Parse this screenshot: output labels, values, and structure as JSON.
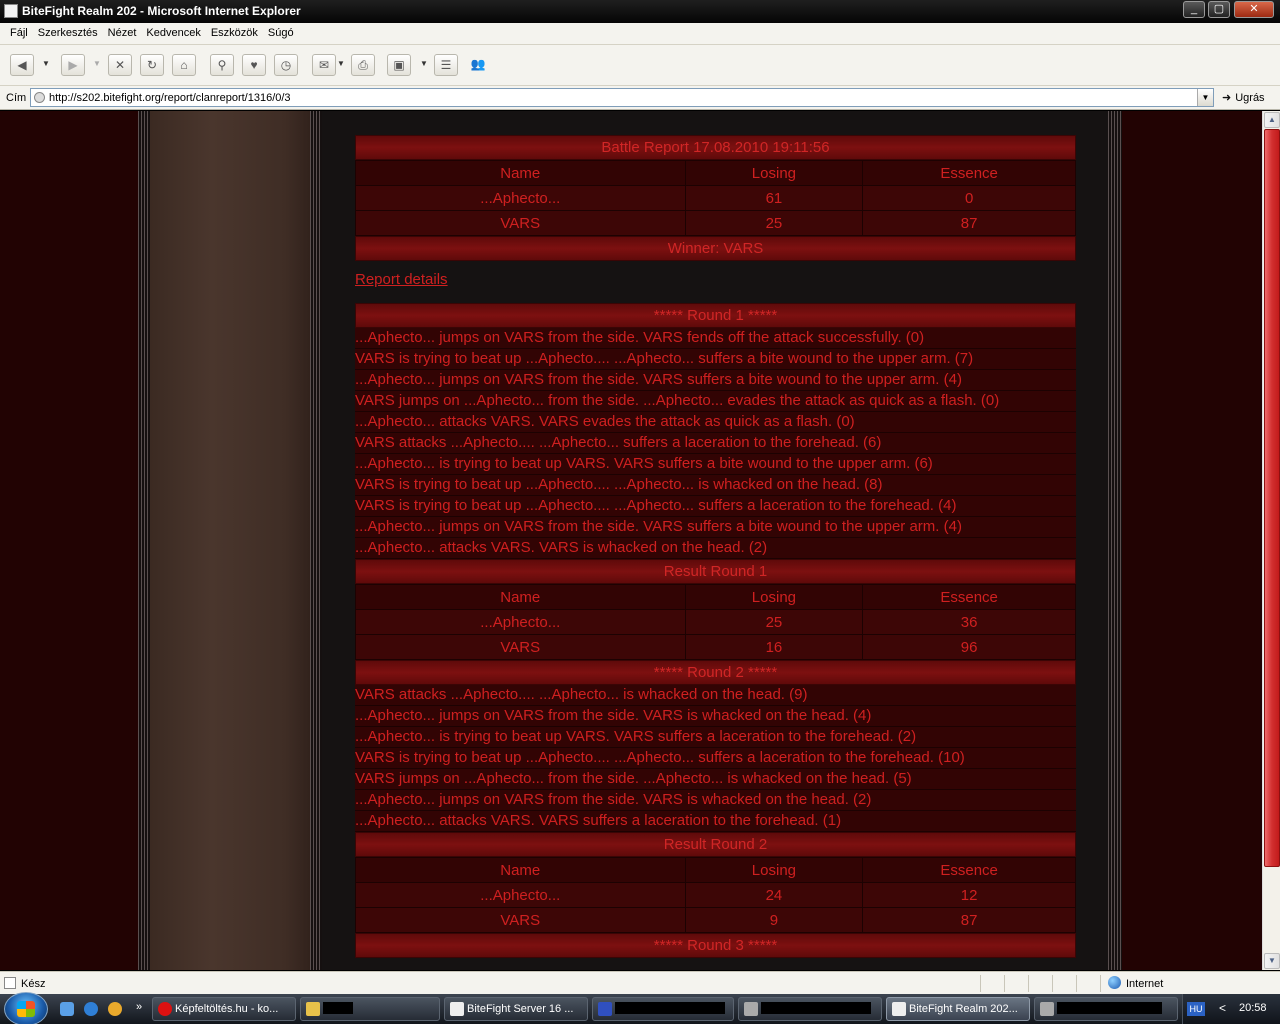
{
  "window": {
    "title": "BiteFight Realm 202 - Microsoft Internet Explorer",
    "minimize": "_",
    "maximize": "▢",
    "close": "✕"
  },
  "menu": [
    "Fájl",
    "Szerkesztés",
    "Nézet",
    "Kedvencek",
    "Eszközök",
    "Súgó"
  ],
  "address": {
    "label": "Cím",
    "url": "http://s202.bitefight.org/report/clanreport/1316/0/3",
    "go_label": "Ugrás"
  },
  "report": {
    "title": "Battle Report 17.08.2010 19:11:56",
    "columns": [
      "Name",
      "Losing",
      "Essence"
    ],
    "rows": [
      [
        "...Aphecto...",
        "61",
        "0"
      ],
      [
        "VARS",
        "25",
        "87"
      ]
    ],
    "winner": "Winner: VARS",
    "details_link": "Report details"
  },
  "rounds": [
    {
      "title": "***** Round 1 *****",
      "lines": [
        "...Aphecto... jumps on VARS from the side. VARS fends off the attack successfully. (0)",
        "VARS is trying to beat up ...Aphecto.... ...Aphecto... suffers a bite wound to the upper arm. (7)",
        "...Aphecto... jumps on VARS from the side. VARS suffers a bite wound to the upper arm. (4)",
        "VARS jumps on ...Aphecto... from the side. ...Aphecto... evades the attack as quick as a flash. (0)",
        "...Aphecto... attacks VARS. VARS evades the attack as quick as a flash. (0)",
        "VARS attacks ...Aphecto.... ...Aphecto... suffers a laceration to the forehead. (6)",
        "...Aphecto... is trying to beat up VARS. VARS suffers a bite wound to the upper arm. (6)",
        "VARS is trying to beat up ...Aphecto.... ...Aphecto... is whacked on the head. (8)",
        "VARS is trying to beat up ...Aphecto.... ...Aphecto... suffers a laceration to the forehead. (4)",
        "...Aphecto... jumps on VARS from the side. VARS suffers a bite wound to the upper arm. (4)",
        "...Aphecto... attacks VARS. VARS is whacked on the head. (2)"
      ],
      "result_title": "Result Round 1",
      "result_rows": [
        [
          "...Aphecto...",
          "25",
          "36"
        ],
        [
          "VARS",
          "16",
          "96"
        ]
      ]
    },
    {
      "title": "***** Round 2 *****",
      "lines": [
        "VARS attacks ...Aphecto.... ...Aphecto... is whacked on the head. (9)",
        "...Aphecto... jumps on VARS from the side. VARS is whacked on the head. (4)",
        "...Aphecto... is trying to beat up VARS. VARS suffers a laceration to the forehead. (2)",
        "VARS is trying to beat up ...Aphecto.... ...Aphecto... suffers a laceration to the forehead. (10)",
        "VARS jumps on ...Aphecto... from the side. ...Aphecto... is whacked on the head. (5)",
        "...Aphecto... jumps on VARS from the side. VARS is whacked on the head. (2)",
        "...Aphecto... attacks VARS. VARS suffers a laceration to the forehead. (1)"
      ],
      "result_title": "Result Round 2",
      "result_rows": [
        [
          "...Aphecto...",
          "24",
          "12"
        ],
        [
          "VARS",
          "9",
          "87"
        ]
      ]
    }
  ],
  "next_round_title": "***** Round 3 *****",
  "status": {
    "text": "Kész",
    "zone": "Internet"
  },
  "taskbar": {
    "more": "»",
    "tasks": [
      {
        "label": "Képfeltöltés.hu - ko...",
        "icon": "opera-icon",
        "color": "#d11"
      },
      {
        "label": "",
        "icon": "folder-icon",
        "color": "#e8c24a"
      },
      {
        "label": "BiteFight Server 16 ...",
        "icon": "ie-page-icon",
        "color": "#eee"
      },
      {
        "label": "",
        "icon": "app-icon",
        "color": "#3050c0"
      },
      {
        "label": "",
        "icon": "app-icon",
        "color": "#aaa"
      },
      {
        "label": "BiteFight Realm 202...",
        "icon": "ie-page-icon",
        "color": "#eee"
      },
      {
        "label": "",
        "icon": "app-icon",
        "color": "#aaa"
      }
    ],
    "lang": "HU",
    "chevron": "<",
    "clock": "20:58"
  }
}
